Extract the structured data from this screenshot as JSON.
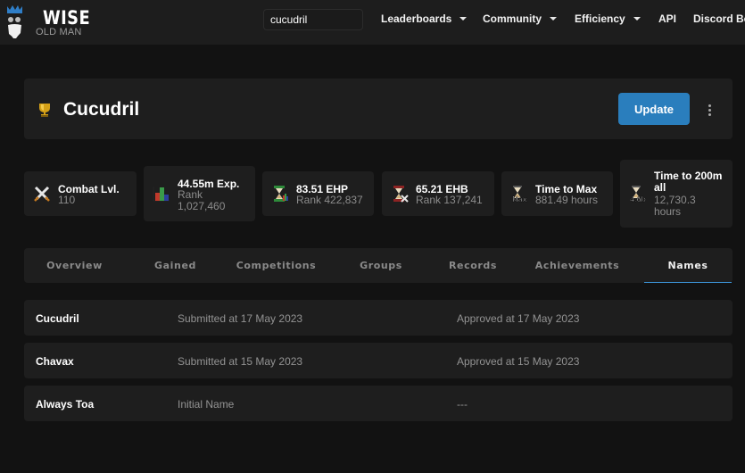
{
  "brand": {
    "title": "WISE",
    "subtitle": "OLD MAN"
  },
  "search": {
    "value": "cucudril"
  },
  "nav": [
    {
      "label": "Leaderboards",
      "dropdown": true
    },
    {
      "label": "Community",
      "dropdown": true
    },
    {
      "label": "Efficiency",
      "dropdown": true
    },
    {
      "label": "API",
      "dropdown": false
    },
    {
      "label": "Discord Bot",
      "dropdown": false
    }
  ],
  "player": {
    "name": "Cucudril",
    "icon": "trophy-icon",
    "update_label": "Update",
    "more_icon": "more-vertical-icon"
  },
  "stats": [
    {
      "icon": "crossed-swords-icon",
      "label": "Combat Lvl.",
      "value": "110"
    },
    {
      "icon": "bar-chart-icon",
      "label": "44.55m Exp.",
      "value": "Rank 1,027,460"
    },
    {
      "icon": "hourglass-skills-icon",
      "label": "83.51 EHP",
      "value": "Rank 422,837"
    },
    {
      "icon": "hourglass-bosses-icon",
      "label": "65.21 EHB",
      "value": "Rank 137,241"
    },
    {
      "icon": "hourglass-max-icon",
      "label": "Time to Max",
      "value": "881.49 hours",
      "badge": "Max"
    },
    {
      "icon": "hourglass-200m-icon",
      "label": "Time to 200m all",
      "value": "12,730.3 hours",
      "badge": "4.6b"
    }
  ],
  "tabs": [
    {
      "label": "Overview",
      "active": false
    },
    {
      "label": "Gained",
      "active": false
    },
    {
      "label": "Competitions",
      "active": false
    },
    {
      "label": "Groups",
      "active": false
    },
    {
      "label": "Records",
      "active": false
    },
    {
      "label": "Achievements",
      "active": false
    },
    {
      "label": "Names",
      "active": true
    }
  ],
  "names": [
    {
      "name": "Cucudril",
      "submitted": "Submitted at 17 May 2023",
      "approved": "Approved at 17 May 2023"
    },
    {
      "name": "Chavax",
      "submitted": "Submitted at 15 May 2023",
      "approved": "Approved at 15 May 2023"
    },
    {
      "name": "Always Toa",
      "submitted": "Initial Name",
      "approved": "---"
    }
  ],
  "colors": {
    "accent": "#2a7ebd",
    "tab_underline": "#3b8fd0",
    "background": "#121212",
    "card": "#1e1e1e"
  }
}
